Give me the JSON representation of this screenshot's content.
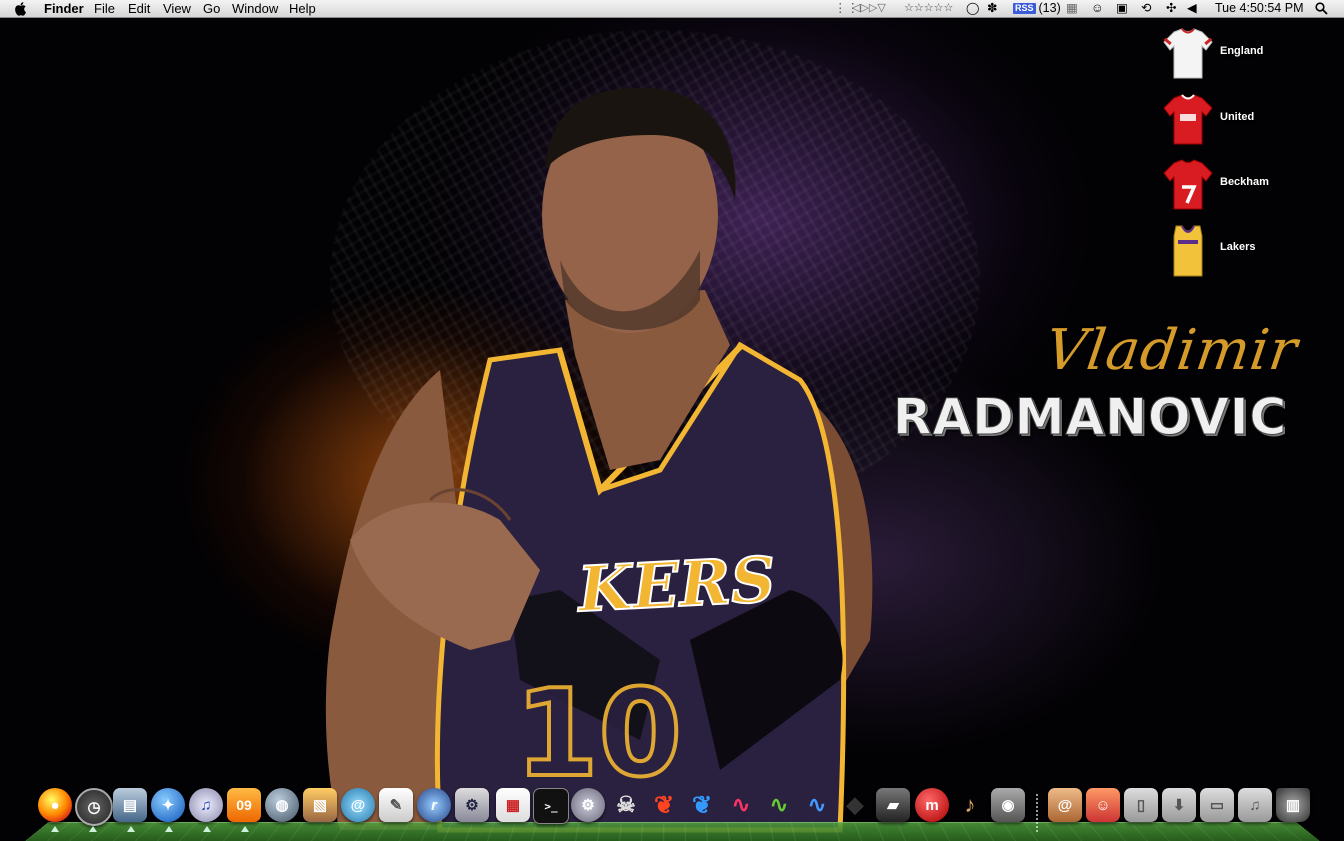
{
  "menubar": {
    "app_name": "Finder",
    "menus": [
      "File",
      "Edit",
      "View",
      "Go",
      "Window",
      "Help"
    ],
    "rss_label": "RSS",
    "rss_count": "(13)",
    "stars": "☆☆☆☆☆",
    "clock": "Tue 4:50:54 PM"
  },
  "desktop_icons": [
    {
      "label": "England"
    },
    {
      "label": "United"
    },
    {
      "label": "Beckham"
    },
    {
      "label": "Lakers"
    }
  ],
  "wallpaper": {
    "first_name": "Vladimir",
    "last_name": "RADMANOVIC",
    "jersey_text": "KERS",
    "jersey_number": "10"
  },
  "dock": {
    "calendar_badge": "09",
    "items": [
      {
        "icon": "apple-icon"
      },
      {
        "icon": "dashboard-icon"
      },
      {
        "icon": "preview-icon"
      },
      {
        "icon": "ichat-icon"
      },
      {
        "icon": "itunes-icon"
      },
      {
        "icon": "iwork-09-icon"
      },
      {
        "icon": "network-globe-icon"
      },
      {
        "icon": "iphoto-icon"
      },
      {
        "icon": "spiral-icon"
      },
      {
        "icon": "textedit-icon"
      },
      {
        "icon": "r-app-icon"
      },
      {
        "icon": "utility-icon"
      },
      {
        "icon": "calendar-icon"
      },
      {
        "icon": "terminal-icon"
      },
      {
        "icon": "system-prefs-icon"
      },
      {
        "icon": "skull-icon"
      },
      {
        "icon": "feather-red-icon"
      },
      {
        "icon": "feather-blue-icon"
      },
      {
        "icon": "creative-suite-icon"
      },
      {
        "icon": "creative-suite-2-icon"
      },
      {
        "icon": "creative-suite-3-icon"
      },
      {
        "icon": "hairdryer-icon"
      },
      {
        "icon": "truck-icon"
      },
      {
        "icon": "m-app-icon"
      },
      {
        "icon": "guitar-icon"
      },
      {
        "icon": "image-capture-icon"
      },
      {
        "icon": "address-book-icon"
      },
      {
        "icon": "character-icon"
      },
      {
        "icon": "documents-folder-icon"
      },
      {
        "icon": "downloads-folder-icon"
      },
      {
        "icon": "applications-folder-icon"
      },
      {
        "icon": "music-folder-icon"
      },
      {
        "icon": "movies-folder-icon"
      },
      {
        "icon": "trash-icon"
      }
    ]
  },
  "colors": {
    "menubar_top": "#f4f4f4",
    "title_gold": "#d49a2a",
    "jersey_purple": "#2a2040",
    "jersey_gold": "#f2b632"
  }
}
